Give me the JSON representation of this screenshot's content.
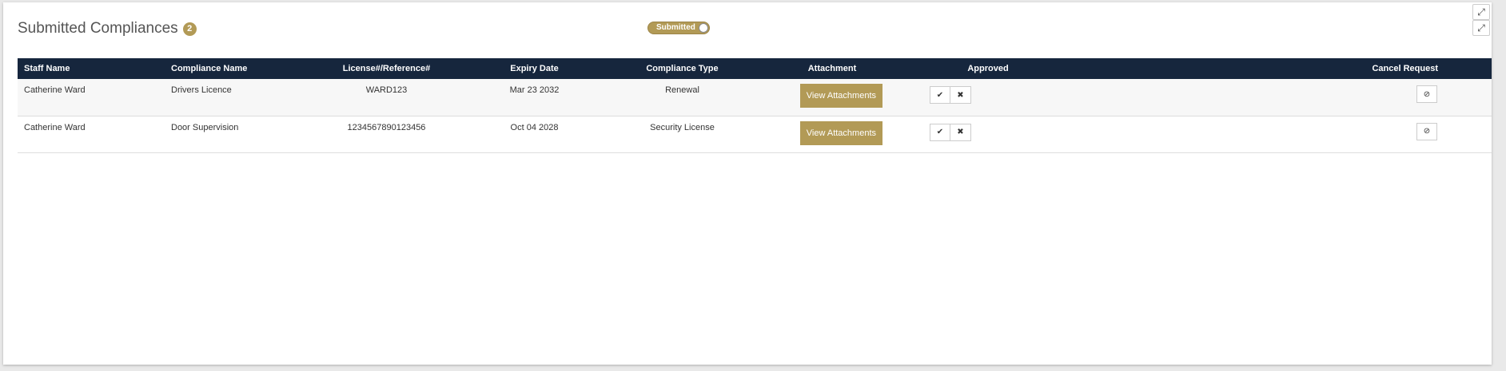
{
  "panel": {
    "title": "Submitted Compliances",
    "count": "2",
    "toggle_label": "Submitted"
  },
  "icons": {
    "expand": "⤢",
    "check": "✔",
    "reject": "✖",
    "cancel": "⊘"
  },
  "table": {
    "headers": {
      "staff_name": "Staff Name",
      "compliance_name": "Compliance Name",
      "license": "License#/Reference#",
      "expiry": "Expiry Date",
      "type": "Compliance Type",
      "attachment": "Attachment",
      "approved": "Approved",
      "cancel": "Cancel Request"
    },
    "attach_label": "View Attachments",
    "rows": [
      {
        "staff_name": "Catherine Ward",
        "compliance_name": "Drivers Licence",
        "license": "WARD123",
        "expiry": "Mar 23 2032",
        "type": "Renewal"
      },
      {
        "staff_name": "Catherine Ward",
        "compliance_name": "Door Supervision",
        "license": "1234567890123456",
        "expiry": "Oct 04 2028",
        "type": "Security License"
      }
    ]
  },
  "colors": {
    "accent": "#b29a56",
    "header_bg": "#16263d"
  }
}
